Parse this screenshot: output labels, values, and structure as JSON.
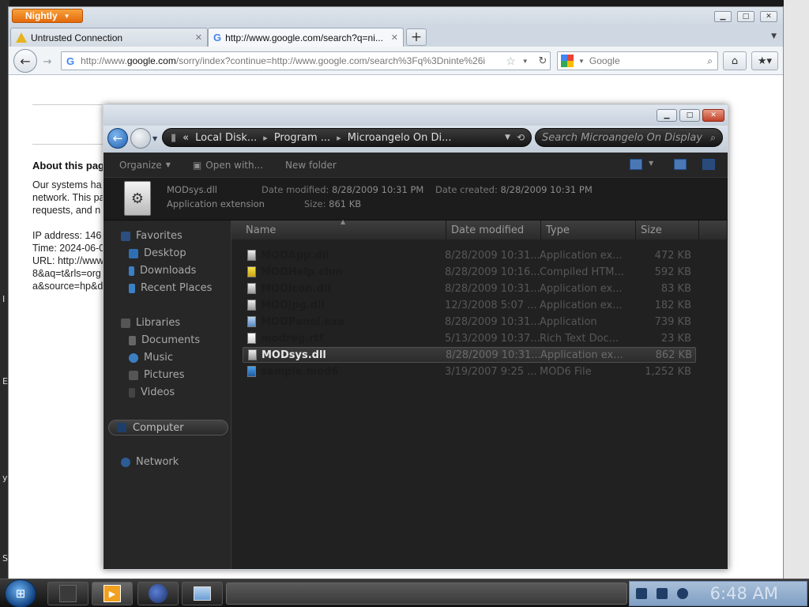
{
  "browser": {
    "app_button": "Nightly",
    "tabs": [
      {
        "label": "Untrusted Connection"
      },
      {
        "label": "http://www.google.com/search?q=ni..."
      }
    ],
    "new_tab": "+",
    "url": {
      "prefix": "http://www.",
      "host": "google.com",
      "rest": "/sorry/index?continue=http://www.google.com/search%3Fq%3Dninte%26i"
    },
    "search_placeholder": "Google"
  },
  "page": {
    "about_heading": "About this pag",
    "para1": [
      "Our systems ha",
      "network. This pa",
      "requests, and n"
    ],
    "info": [
      "IP address: 146",
      "Time: 2024-06-0",
      "URL: http://www",
      "8&aq=t&rls=org",
      "a&source=hp&d"
    ]
  },
  "desktop_fragments": [
    "I",
    "E",
    "y",
    "S"
  ],
  "explorer": {
    "address": {
      "prefix": "«",
      "crumbs": [
        "Local Disk...",
        "Program ...",
        "Microangelo On Di..."
      ]
    },
    "search_placeholder": "Search Microangelo On Display",
    "toolbar": {
      "organize": "Organize",
      "open_with": "Open with...",
      "new_folder": "New folder"
    },
    "details": {
      "name": "MODsys.dll",
      "modified_label": "Date modified:",
      "modified": "8/28/2009 10:31 PM",
      "created_label": "Date created:",
      "created": "8/28/2009 10:31 PM",
      "kind": "Application extension",
      "size_label": "Size:",
      "size": "861 KB"
    },
    "sidebar": {
      "favorites": "Favorites",
      "fav_items": [
        "Desktop",
        "Downloads",
        "Recent Places"
      ],
      "libraries": "Libraries",
      "lib_items": [
        "Documents",
        "Music",
        "Pictures",
        "Videos"
      ],
      "computer": "Computer",
      "network": "Network"
    },
    "columns": {
      "name": "Name",
      "date": "Date modified",
      "type": "Type",
      "size": "Size"
    },
    "files": [
      {
        "name": "MODApp.dll",
        "date": "8/28/2009 10:31...",
        "type": "Application ex...",
        "size": "472 KB"
      },
      {
        "name": "MODHelp.chm",
        "date": "8/28/2009 10:16...",
        "type": "Compiled HTM...",
        "size": "592 KB"
      },
      {
        "name": "MODIcon.dll",
        "date": "8/28/2009 10:31...",
        "type": "Application ex...",
        "size": "83 KB"
      },
      {
        "name": "MODjpg.dll",
        "date": "12/3/2008 5:07 ...",
        "type": "Application ex...",
        "size": "182 KB"
      },
      {
        "name": "MODPanel.exe",
        "date": "8/28/2009 10:31...",
        "type": "Application",
        "size": "739 KB"
      },
      {
        "name": "modreg.rtf",
        "date": "5/13/2009 10:37...",
        "type": "Rich Text Doc...",
        "size": "23 KB"
      },
      {
        "name": "MODsys.dll",
        "date": "8/28/2009 10:31...",
        "type": "Application ex...",
        "size": "862 KB"
      },
      {
        "name": "sample.mod6",
        "date": "3/19/2007 9:25 ...",
        "type": "MOD6 File",
        "size": "1,252 KB"
      }
    ]
  },
  "taskbar": {
    "clock": "6:48 AM"
  },
  "colors": {
    "nightly_orange": "#e46a0c",
    "explorer_dark": "#202020",
    "selection": "#3a3a3a",
    "start_blue": "#1f5fae"
  }
}
